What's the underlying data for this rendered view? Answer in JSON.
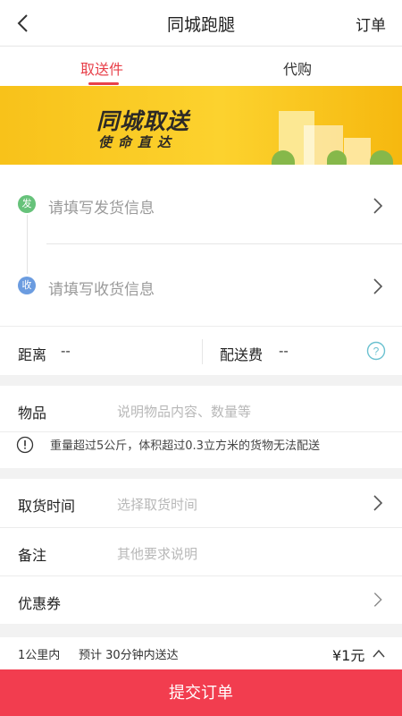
{
  "header": {
    "title": "同城跑腿",
    "orders_label": "订单"
  },
  "tabs": [
    {
      "label": "取送件",
      "active": true
    },
    {
      "label": "代购",
      "active": false
    }
  ],
  "banner": {
    "title": "同城取送",
    "subtitle": "使命直达"
  },
  "address": {
    "send_badge": "发",
    "send_placeholder": "请填写发货信息",
    "receive_badge": "收",
    "receive_placeholder": "请填写收货信息"
  },
  "distance": {
    "distance_label": "距离",
    "distance_value": "--",
    "fee_label": "配送费",
    "fee_value": "--"
  },
  "goods": {
    "label": "物品",
    "placeholder": "说明物品内容、数量等",
    "warning": "重量超过5公斤，体积超过0.3立方米的货物无法配送"
  },
  "pickup": {
    "label": "取货时间",
    "placeholder": "选择取货时间"
  },
  "remark": {
    "label": "备注",
    "placeholder": "其他要求说明"
  },
  "coupon": {
    "label": "优惠券"
  },
  "summary": {
    "range": "1公里内",
    "eta": "预计 30分钟内送达",
    "price": "¥1元"
  },
  "submit_label": "提交订单",
  "colors": {
    "accent": "#f23d4f",
    "tab_active": "#e8404a",
    "send_badge": "#66c27a",
    "receive_badge": "#6b9ce0",
    "help_icon": "#6bc1d0"
  }
}
